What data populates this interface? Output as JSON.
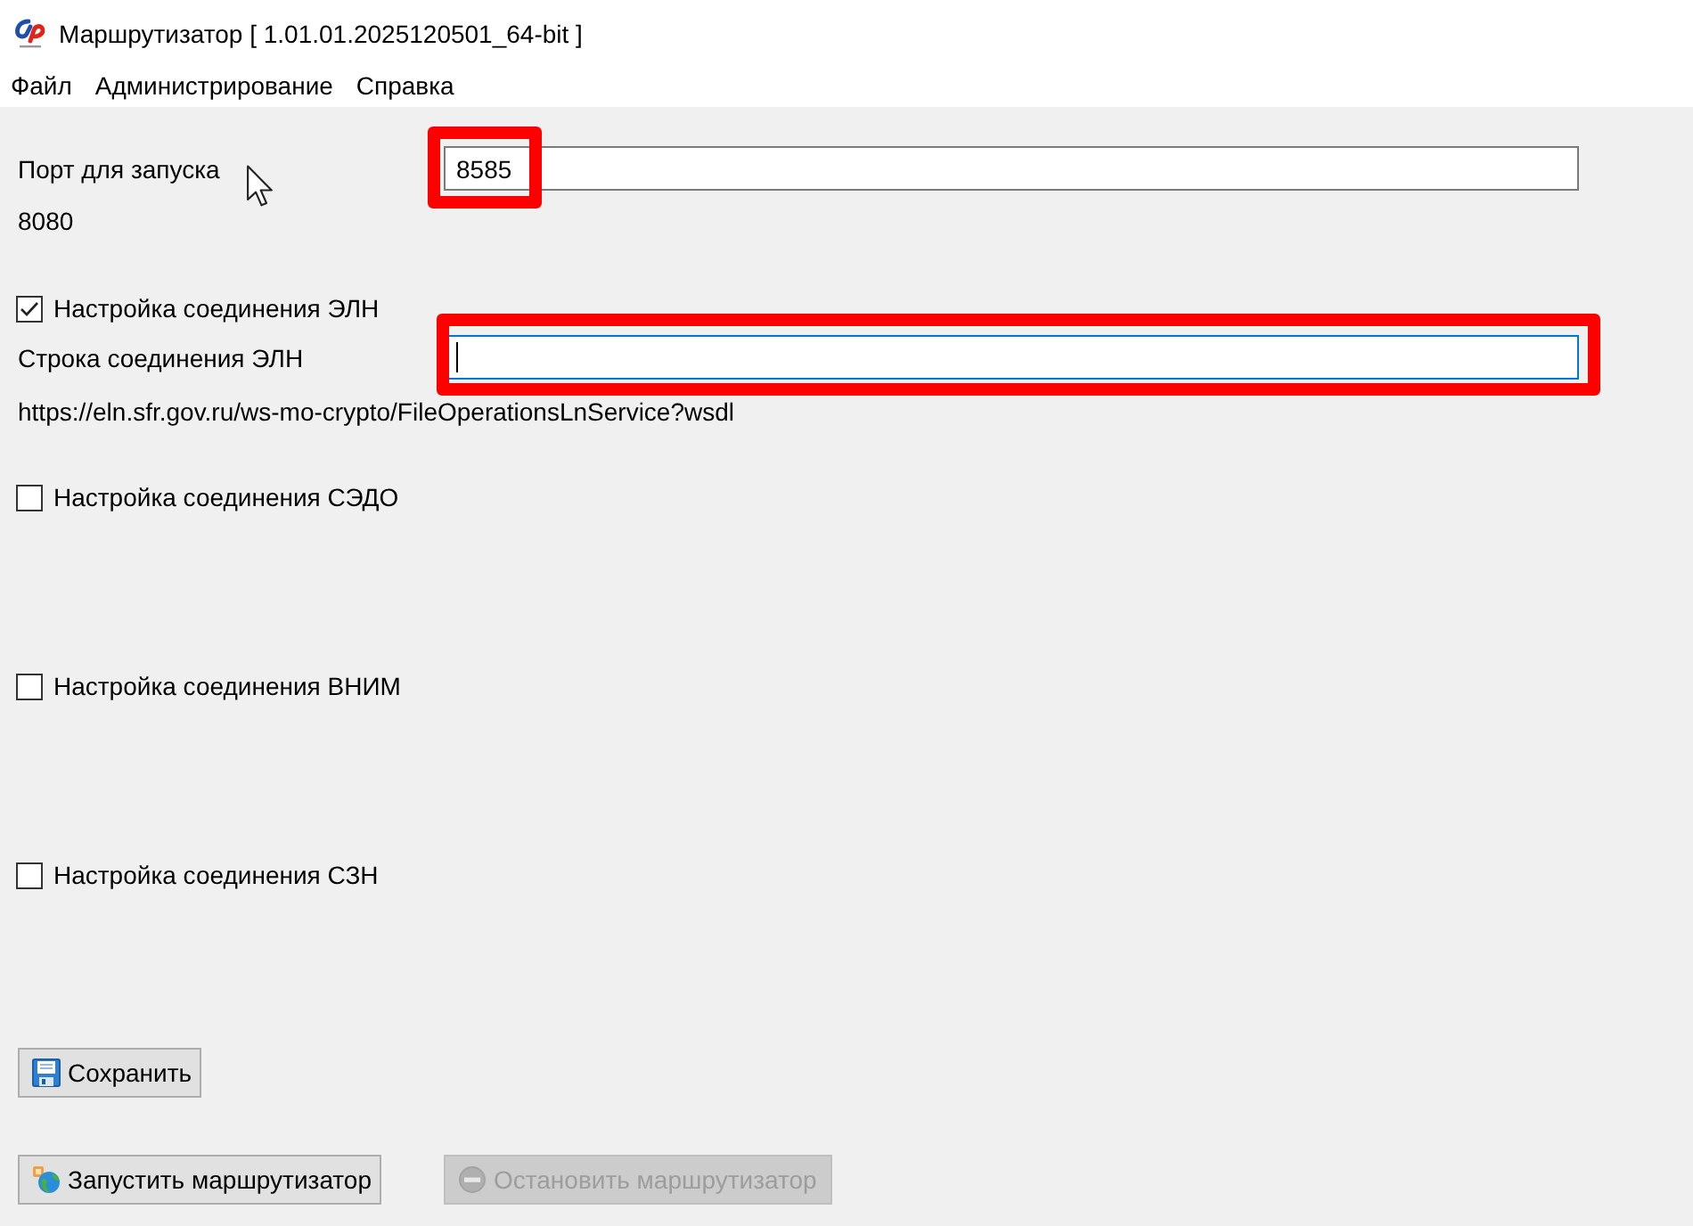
{
  "window": {
    "title": "Маршрутизатор [ 1.01.01.2025120501_64-bit ]"
  },
  "menu": [
    "Файл",
    "Администрирование",
    "Справка"
  ],
  "port": {
    "label": "Порт для запуска",
    "value": "8585",
    "highlighted": true,
    "current": "8080"
  },
  "sections": [
    {
      "label": "Настройка соединения ЭЛН",
      "checked": true,
      "field": {
        "label": "Строка соединения ЭЛН",
        "focused": true,
        "highlighted": true
      },
      "current": "https://eln.sfr.gov.ru/ws-mo-crypto/FileOperationsLnService?wsdl"
    },
    {
      "label": "Настройка соединения СЭДО",
      "checked": false
    },
    {
      "label": "Настройка соединения ВНИМ",
      "checked": false
    },
    {
      "label": "Настройка соединения СЗН",
      "checked": false
    }
  ],
  "buttons": [
    {
      "kind": "save",
      "label": "Сохранить",
      "disabled": false
    }
  ],
  "actions": [
    {
      "kind": "start",
      "label": "Запустить маршрутизатор",
      "disabled": false
    },
    {
      "kind": "stop",
      "label": "Остановить маршрутизатор",
      "disabled": true
    }
  ]
}
